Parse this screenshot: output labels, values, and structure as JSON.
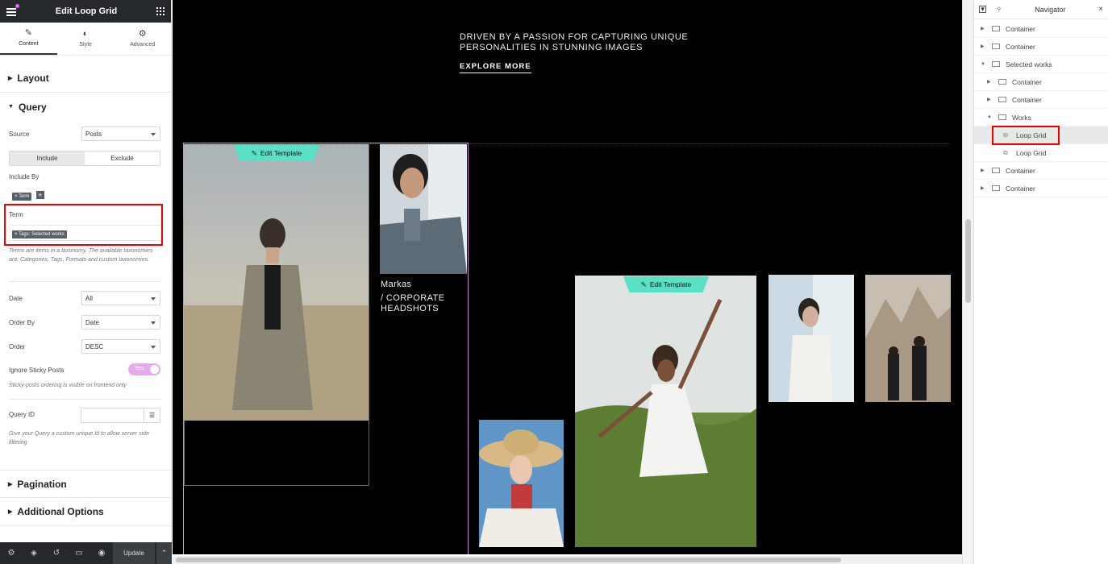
{
  "panel": {
    "title": "Edit Loop Grid",
    "tabs": [
      {
        "label": "Content",
        "icon": "pencil-icon"
      },
      {
        "label": "Style",
        "icon": "half-circle-icon"
      },
      {
        "label": "Advanced",
        "icon": "gear-icon"
      }
    ],
    "sections": {
      "layout": "Layout",
      "query": "Query",
      "pagination": "Pagination",
      "additional": "Additional Options"
    },
    "query": {
      "source_label": "Source",
      "source_value": "Posts",
      "include_tab": "Include",
      "exclude_tab": "Exclude",
      "include_by_label": "Include By",
      "include_by_chip": "× Term",
      "term_label": "Term",
      "term_chip": "× Tags: Selected works",
      "term_hint": "Terms are items in a taxonomy. The available taxonomies are: Categories, Tags, Formats and custom taxonomies.",
      "date_label": "Date",
      "date_value": "All",
      "order_by_label": "Order By",
      "order_by_value": "Date",
      "order_label": "Order",
      "order_value": "DESC",
      "sticky_label": "Ignore Sticky Posts",
      "sticky_value": "Yes",
      "sticky_hint": "Sticky-posts ordering is visible on frontend only",
      "query_id_label": "Query ID",
      "query_id_value": "",
      "query_id_hint": "Give your Query a custom unique Id to allow server side filtering"
    },
    "footer": {
      "update_label": "Update"
    }
  },
  "canvas": {
    "hero_line1": "DRIVEN BY A PASSION FOR CAPTURING UNIQUE",
    "hero_line2": "PERSONALITIES IN STUNNING IMAGES",
    "explore": "EXPLORE MORE",
    "edit_template": "Edit Template",
    "caption_name": "Markas",
    "caption_line1": "/ CORPORATE",
    "caption_line2": "HEADSHOTS"
  },
  "navigator": {
    "title": "Navigator",
    "items": [
      {
        "label": "Container"
      },
      {
        "label": "Container"
      },
      {
        "label": "Selected works"
      },
      {
        "label": "Container"
      },
      {
        "label": "Container"
      },
      {
        "label": "Works"
      },
      {
        "label": "Loop Grid"
      },
      {
        "label": "Loop Grid"
      },
      {
        "label": "Container"
      },
      {
        "label": "Container"
      }
    ]
  },
  "colors": {
    "accent_teal": "#59e0c5",
    "accent_pink": "#e7a8ef",
    "highlight_red": "#e00000",
    "panel_dark": "#26292c"
  }
}
